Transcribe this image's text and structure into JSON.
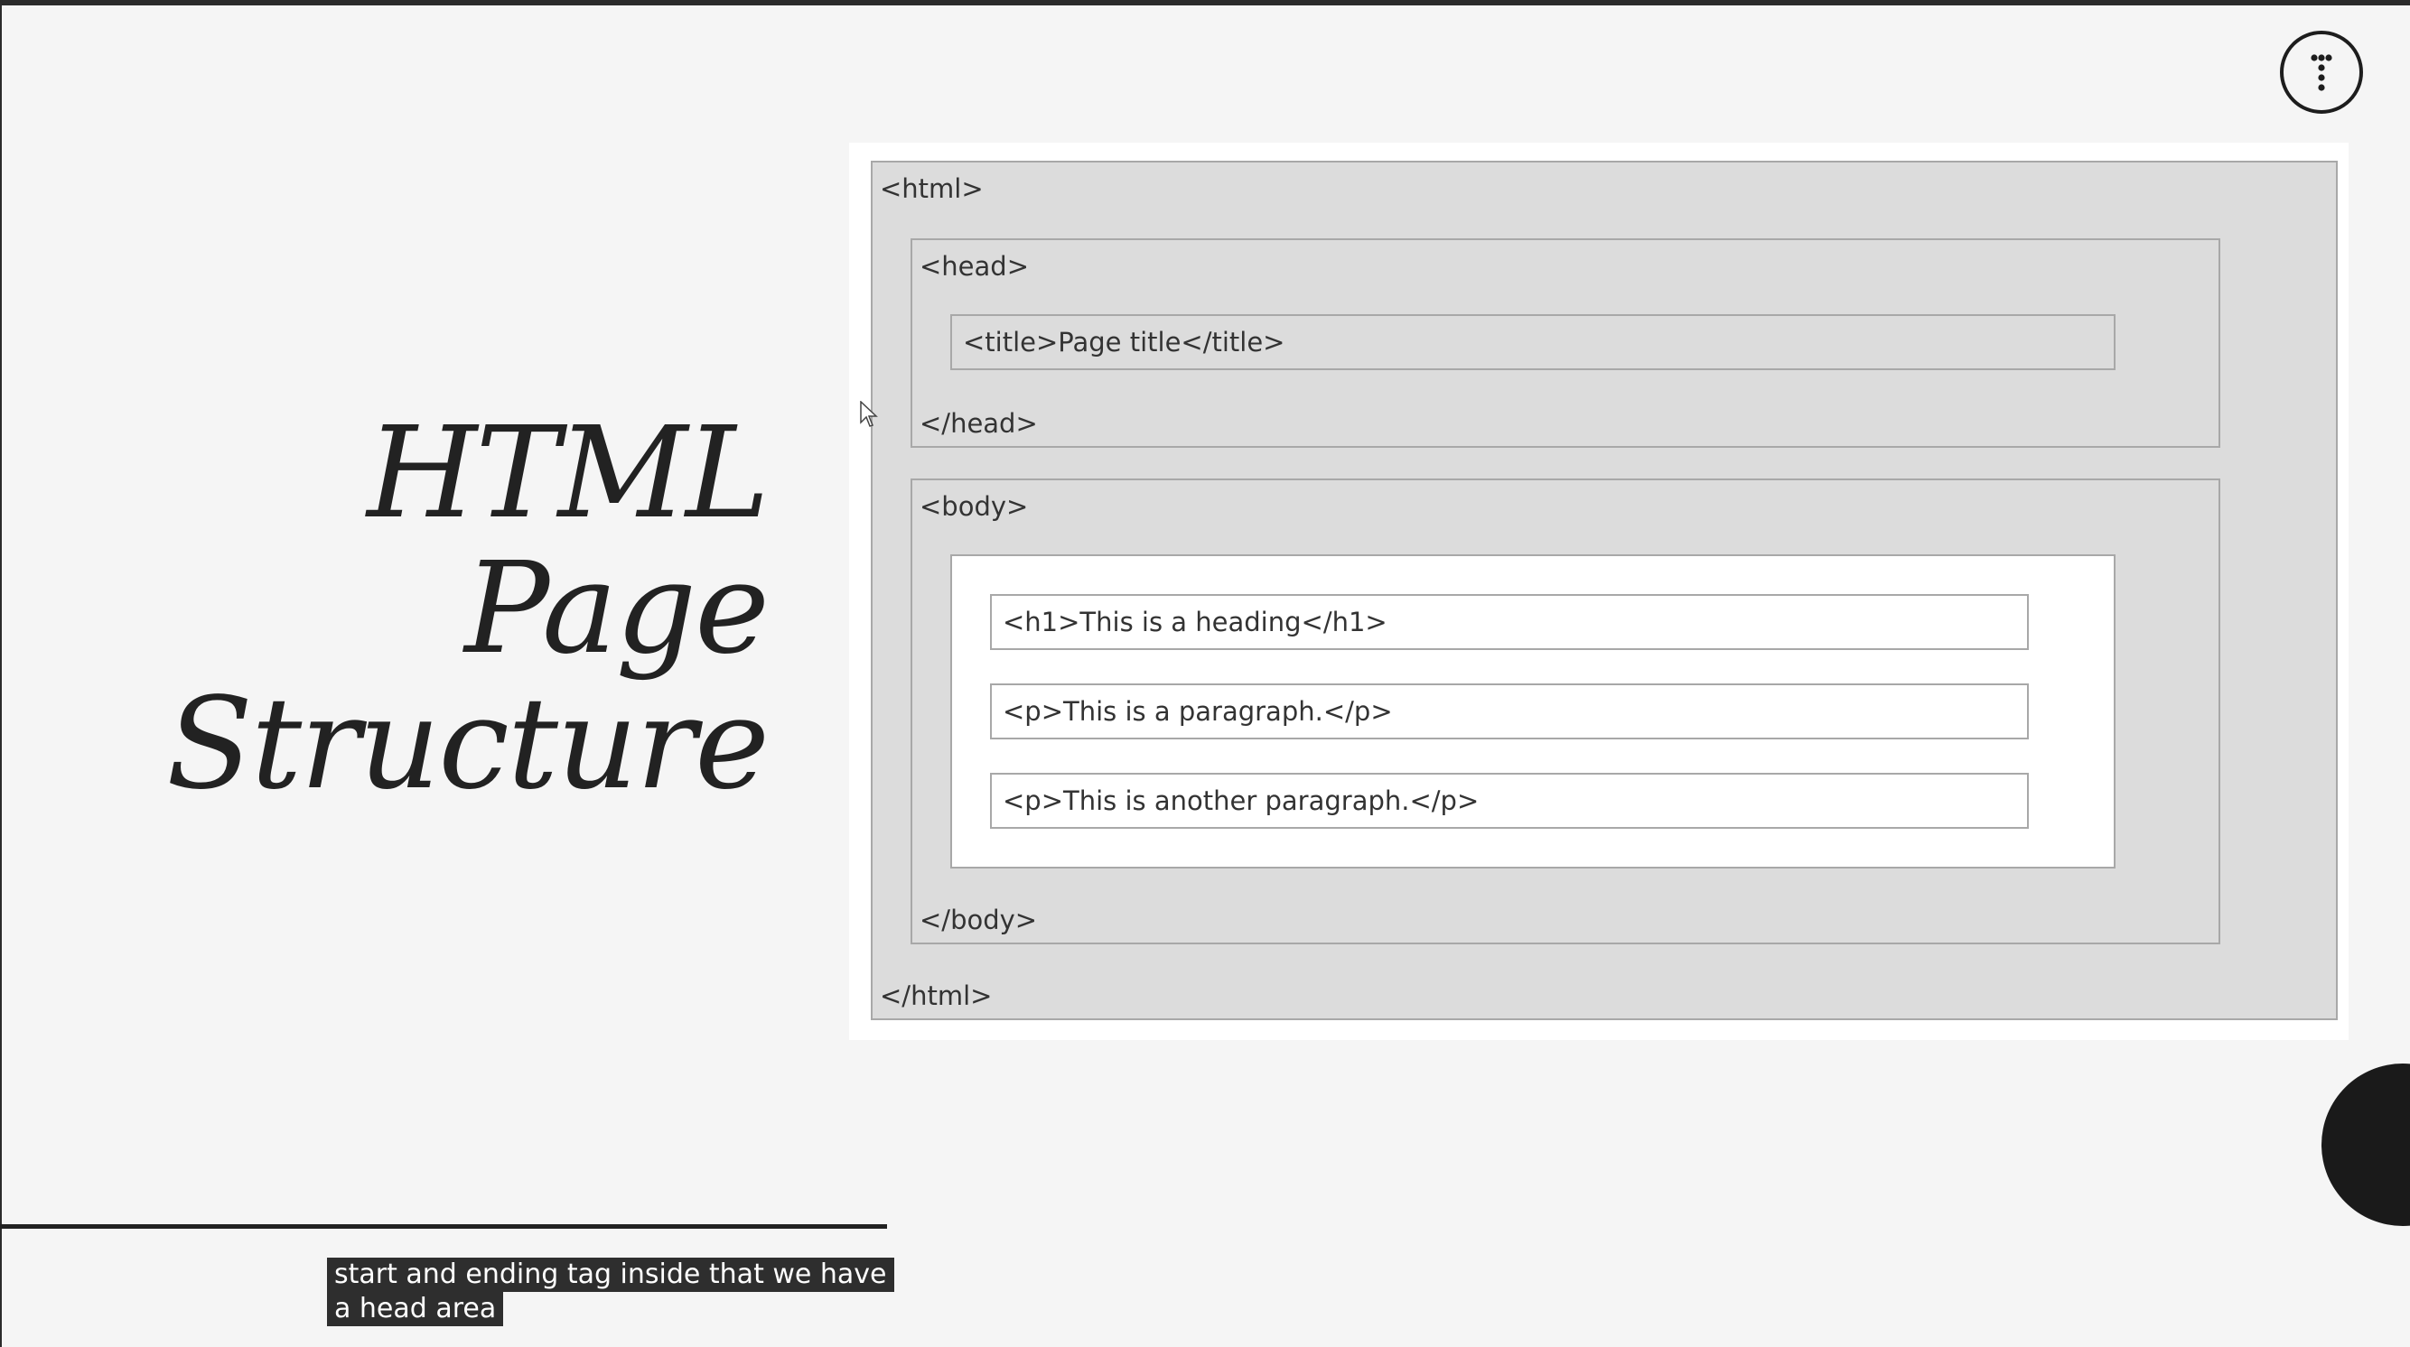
{
  "slide": {
    "title_line1": "HTML Page",
    "title_line2": "Structure"
  },
  "diagram": {
    "html_open": "<html>",
    "head_open": "<head>",
    "title_element": "<title>Page title</title>",
    "head_close": "</head>",
    "body_open": "<body>",
    "h1_element": "<h1>This is a heading</h1>",
    "p1_element": "<p>This is a paragraph.</p>",
    "p2_element": "<p>This is another paragraph.</p>",
    "body_close": "</body>",
    "html_close": "</html>"
  },
  "caption": {
    "line1": "start and ending tag inside that we have",
    "line2": "a head area"
  },
  "icons": {
    "menu": "vertical-dots-menu-icon",
    "cursor": "mouse-pointer-icon"
  },
  "colors": {
    "background": "#f5f5f5",
    "box_gray": "#dcdcdc",
    "box_border": "#a8a8a8",
    "text": "#333333",
    "caption_bg": "#2e2e2e"
  }
}
